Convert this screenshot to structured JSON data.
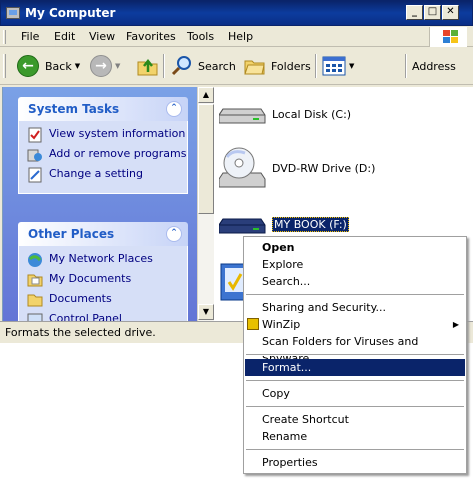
{
  "window": {
    "title": "My Computer",
    "caption_buttons": {
      "minimize": "_",
      "maximize": "□",
      "close": "✕"
    }
  },
  "menu": [
    "File",
    "Edit",
    "View",
    "Favorites",
    "Tools",
    "Help"
  ],
  "toolbar": {
    "back_label": "Back",
    "search_label": "Search",
    "folders_label": "Folders",
    "address_label": "Address"
  },
  "system_tasks": {
    "title": "System Tasks",
    "items": [
      "View system information",
      "Add or remove programs",
      "Change a setting"
    ]
  },
  "other_places": {
    "title": "Other Places",
    "items": [
      "My Network Places",
      "My Documents",
      "Documents",
      "Control Panel"
    ]
  },
  "drives": [
    {
      "label": "Local Disk (C:)",
      "icon": "hard-disk-icon"
    },
    {
      "label": "DVD-RW Drive (D:)",
      "icon": "dvd-drive-icon"
    },
    {
      "label": "MY BOOK (F:)",
      "icon": "external-drive-icon",
      "selected": true
    }
  ],
  "status": "Formats the selected drive.",
  "context_menu": {
    "open": "Open",
    "explore": "Explore",
    "search": "Search...",
    "sharing": "Sharing and Security...",
    "winzip": "WinZip",
    "scan": "Scan Folders for Viruses and Spyware",
    "format": "Format...",
    "copy": "Copy",
    "create_shortcut": "Create Shortcut",
    "rename": "Rename",
    "properties": "Properties"
  },
  "colors": {
    "title_bar": "#0a246a",
    "selection": "#0a246a",
    "task_link": "#000080",
    "task_header": "#215dc6"
  }
}
